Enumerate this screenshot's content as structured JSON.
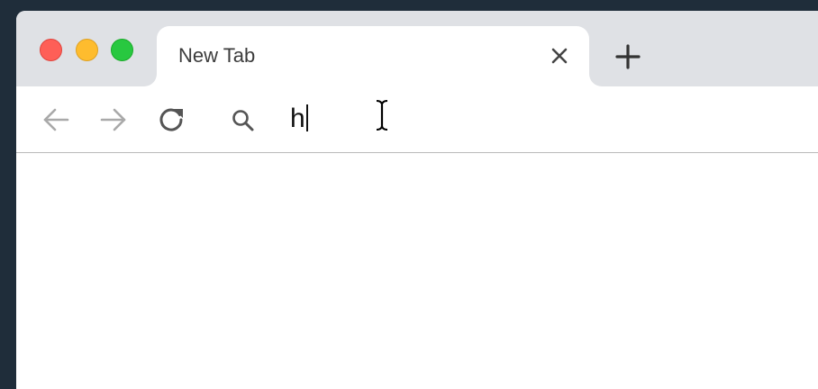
{
  "window": {
    "traffic_lights": [
      {
        "name": "close",
        "color": "#fe5f57"
      },
      {
        "name": "minimize",
        "color": "#febc2e"
      },
      {
        "name": "zoom",
        "color": "#28c840"
      }
    ]
  },
  "tabs": [
    {
      "title": "New Tab",
      "active": true,
      "close_icon": "close-icon"
    }
  ],
  "new_tab_icon": "plus-icon",
  "toolbar": {
    "back_icon": "arrow-left-icon",
    "forward_icon": "arrow-right-icon",
    "reload_icon": "reload-icon",
    "search_icon": "search-icon",
    "address_value": "h"
  },
  "colors": {
    "titlebar": "#dfe1e5",
    "tab_active": "#ffffff",
    "icon_disabled": "#a9a9a9",
    "icon_active": "#555555"
  }
}
